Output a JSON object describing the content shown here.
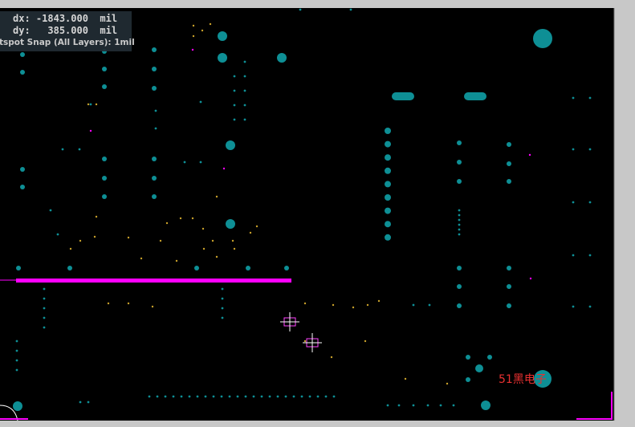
{
  "hud": {
    "dx_label": "dx:",
    "dx_value": "-1843.000",
    "dy_label": "dy:",
    "dy_value": "385.000",
    "unit": "mil",
    "snap_text": "tspot Snap (All Layers): 1mil"
  },
  "watermark": "51黑电子",
  "colors": {
    "background": "#000000",
    "pad": "#0e8f95",
    "magenta": "#ff00ff",
    "frame": "#c8c8c8",
    "via": "#c8a02a"
  },
  "icons": {
    "crosshair_1": "crosshair-icon",
    "crosshair_2": "crosshair-icon"
  }
}
